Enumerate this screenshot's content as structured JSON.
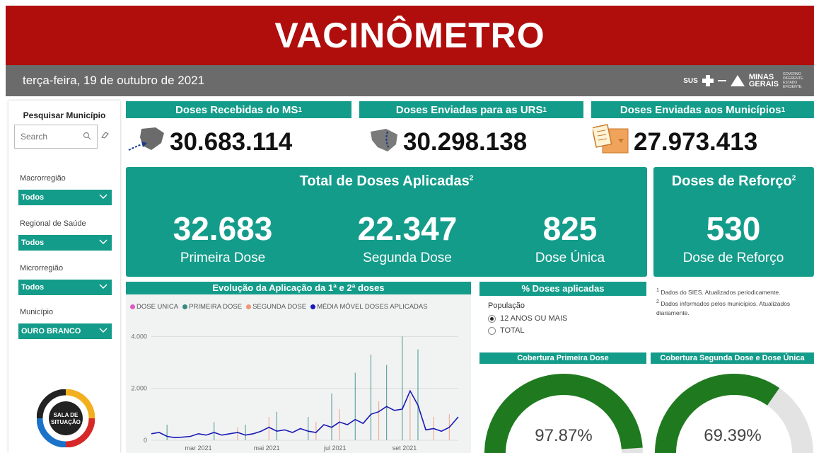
{
  "header": {
    "title": "VACINÔMETRO",
    "date": "terça-feira, 19 de outubro de 2021"
  },
  "logos": {
    "sus": "SUS",
    "minas_line1": "MINAS",
    "minas_line2": "GERAIS",
    "gov": "GOVERNO DIFERENTE. ESTADO EFICIENTE."
  },
  "sidebar": {
    "search_title": "Pesquisar Município",
    "search_placeholder": "Search",
    "filters": [
      {
        "label": "Macrorregião",
        "value": "Todos"
      },
      {
        "label": "Regional de Saúde",
        "value": "Todos"
      },
      {
        "label": "Microrregião",
        "value": "Todos"
      },
      {
        "label": "Município",
        "value": "OURO BRANCO"
      }
    ],
    "logo_text_1": "SALA DE",
    "logo_text_2": "SITUAÇÃO"
  },
  "cards": [
    {
      "title": "Doses Recebidas do MS",
      "sup": "1",
      "value": "30.683.114",
      "icon": "map-arrow-icon"
    },
    {
      "title": "Doses Enviadas para as URS",
      "sup": "1",
      "value": "30.298.138",
      "icon": "map-route-icon"
    },
    {
      "title": "Doses Enviadas aos Municípios",
      "sup": "1",
      "value": "27.973.413",
      "icon": "box-clipboard-icon"
    }
  ],
  "total_panel": {
    "title": "Total de Doses Aplicadas",
    "sup": "2",
    "stats": [
      {
        "value": "32.683",
        "label": "Primeira Dose"
      },
      {
        "value": "22.347",
        "label": "Segunda Dose"
      },
      {
        "value": "825",
        "label": "Dose Única"
      }
    ]
  },
  "booster_panel": {
    "title": "Doses de Reforço",
    "sup": "2",
    "value": "530",
    "label": "Dose de Reforço"
  },
  "chart": {
    "title": "Evolução da Aplicação da 1ª e 2ª doses",
    "legend": [
      {
        "name": "DOSE UNICA",
        "color": "#e05bbf"
      },
      {
        "name": "PRIMEIRA DOSE",
        "color": "#3a8a80"
      },
      {
        "name": "SEGUNDA DOSE",
        "color": "#f0957a"
      },
      {
        "name": "MÉDIA MÓVEL DOSES APLICADAS",
        "color": "#1a1ab5"
      }
    ]
  },
  "chart_data": {
    "type": "line",
    "title": "Evolução da Aplicação da 1ª e 2ª doses",
    "y_ticks": [
      "0",
      "2.000",
      "4.000"
    ],
    "ylim": [
      0,
      4200
    ],
    "x_ticks": [
      "mar 2021",
      "mai 2021",
      "jul 2021",
      "set 2021"
    ],
    "x_start": "2021-01-18",
    "x_end": "2021-10-19",
    "series": [
      {
        "name": "MÉDIA MÓVEL DOSES APLICADAS",
        "type": "line",
        "color": "#1a1ab5",
        "x": [
          "2021-01-18",
          "2021-01-25",
          "2021-02-01",
          "2021-02-08",
          "2021-02-15",
          "2021-02-22",
          "2021-03-01",
          "2021-03-08",
          "2021-03-15",
          "2021-03-22",
          "2021-03-29",
          "2021-04-05",
          "2021-04-12",
          "2021-04-19",
          "2021-04-26",
          "2021-05-03",
          "2021-05-10",
          "2021-05-17",
          "2021-05-24",
          "2021-05-31",
          "2021-06-07",
          "2021-06-14",
          "2021-06-21",
          "2021-06-28",
          "2021-07-05",
          "2021-07-12",
          "2021-07-19",
          "2021-07-26",
          "2021-08-02",
          "2021-08-09",
          "2021-08-16",
          "2021-08-23",
          "2021-08-30",
          "2021-09-06",
          "2021-09-13",
          "2021-09-20",
          "2021-09-27",
          "2021-10-04",
          "2021-10-11",
          "2021-10-19"
        ],
        "y": [
          250,
          300,
          150,
          100,
          120,
          150,
          250,
          200,
          300,
          200,
          250,
          300,
          200,
          250,
          350,
          500,
          350,
          400,
          300,
          450,
          350,
          300,
          600,
          500,
          700,
          600,
          800,
          650,
          1000,
          1100,
          1300,
          1150,
          1200,
          1900,
          1350,
          400,
          450,
          350,
          500,
          900
        ]
      },
      {
        "name": "PRIMEIRA DOSE",
        "type": "bar",
        "color": "#3a8a80",
        "x": [
          "2021-02-01",
          "2021-03-15",
          "2021-04-12",
          "2021-05-10",
          "2021-06-07",
          "2021-06-28",
          "2021-07-19",
          "2021-08-02",
          "2021-08-16",
          "2021-08-30",
          "2021-09-13"
        ],
        "y": [
          600,
          700,
          600,
          1100,
          900,
          1800,
          2600,
          3300,
          2900,
          4000,
          3500
        ]
      },
      {
        "name": "SEGUNDA DOSE",
        "type": "bar",
        "color": "#f0957a",
        "x": [
          "2021-04-05",
          "2021-05-03",
          "2021-06-14",
          "2021-07-05",
          "2021-08-09",
          "2021-09-06",
          "2021-09-27",
          "2021-10-11"
        ],
        "y": [
          500,
          900,
          700,
          1200,
          1500,
          1700,
          900,
          1000
        ]
      }
    ]
  },
  "pct_panel": {
    "title": "% Doses aplicadas",
    "population_label": "População",
    "options": [
      {
        "label": "12 ANOS OU MAIS",
        "selected": true
      },
      {
        "label": "TOTAL",
        "selected": false
      }
    ]
  },
  "notes": [
    {
      "sup": "1",
      "text": "Dados do SIES. Atualizados periodicamente."
    },
    {
      "sup": "2",
      "text": "Dados informados pelos municípios. Atualizados diariamente."
    }
  ],
  "gauges": [
    {
      "title": "Cobertura Primeira Dose",
      "value_text": "97.87%",
      "fraction": 0.9787,
      "color": "#1f7a1f"
    },
    {
      "title": "Cobertura Segunda Dose e Dose Única",
      "value_text": "69.39%",
      "fraction": 0.6939,
      "color": "#1f7a1f"
    }
  ]
}
